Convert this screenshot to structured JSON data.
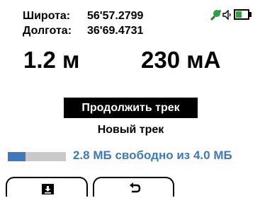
{
  "coordinates": {
    "latitude_label": "Широта:",
    "latitude_value": "56'57.2799",
    "longitude_label": "Долгота:",
    "longitude_value": "36'69.4731"
  },
  "status": {
    "satellite_icon": "satellite-icon",
    "volume_icon": "volume-icon",
    "battery_icon": "battery-icon",
    "battery_level": 0.45,
    "accent_color": "#2ea043"
  },
  "readings": {
    "distance": "1.2 м",
    "current": "230 мА"
  },
  "menu": {
    "items": [
      {
        "label": "Продолжить трек",
        "selected": true
      },
      {
        "label": "Новый трек",
        "selected": false
      }
    ]
  },
  "memory": {
    "used_fraction": 0.3,
    "text": "2.8 МБ свободно из 4.0 МБ",
    "bar_color": "#3f78bd"
  },
  "softkeys": {
    "left_icon": "download-icon",
    "right_icon": "back-arrow-icon"
  }
}
